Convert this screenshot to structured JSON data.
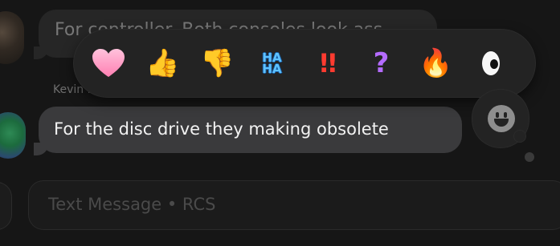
{
  "messages": {
    "previous": {
      "text": "For controller. Both consoles look ass"
    },
    "sender_name": "Kevin Mendoza",
    "current": {
      "text": "For the disc drive they making obsolete"
    }
  },
  "tapback": {
    "reactions": [
      {
        "name": "heart-icon",
        "glyph": "heart"
      },
      {
        "name": "thumbs-up-icon",
        "glyph": "👍"
      },
      {
        "name": "thumbs-down-icon",
        "glyph": "👎"
      },
      {
        "name": "haha-icon",
        "text": "HA\nHA"
      },
      {
        "name": "exclamation-icon",
        "text": "!!"
      },
      {
        "name": "question-icon",
        "text": "?"
      },
      {
        "name": "fire-icon",
        "glyph": "🔥"
      },
      {
        "name": "eyes-icon",
        "glyph": "eyes"
      }
    ],
    "haha_line1": "HA",
    "haha_line2": "HA",
    "exclaim": "!!",
    "question": "?",
    "thumbs_up": "👍",
    "thumbs_down": "👎",
    "fire": "🔥"
  },
  "composer": {
    "placeholder": "Text Message • RCS"
  },
  "colors": {
    "background": "#161616",
    "incoming_bubble": "#3a3a3c",
    "heart": "#ff8fbd",
    "haha": "#5ec2ff",
    "exclaim": "#ff3b30",
    "question": "#b46bff"
  }
}
